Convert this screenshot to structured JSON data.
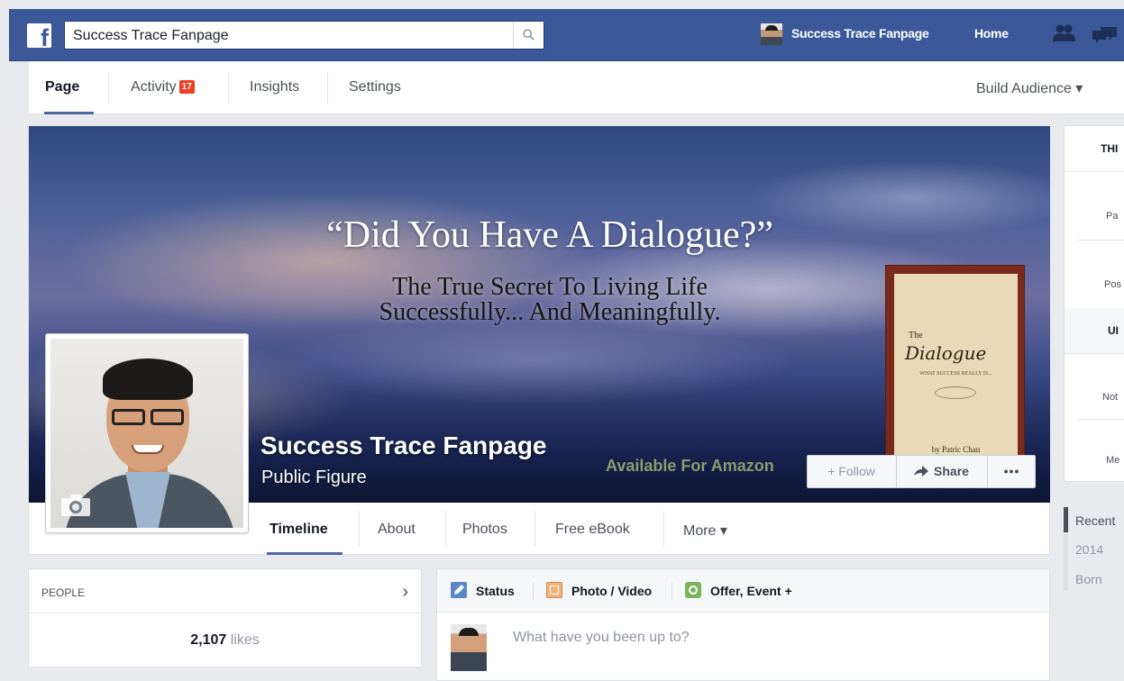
{
  "topbar": {
    "search_value": "Success Trace Fanpage",
    "user_name": "Success Trace Fanpage",
    "home_label": "Home",
    "brand_color": "#3b5998"
  },
  "page_nav": {
    "items": [
      {
        "label": "Page"
      },
      {
        "label": "Activity",
        "badge": "17"
      },
      {
        "label": "Insights"
      },
      {
        "label": "Settings"
      }
    ],
    "build_audience": "Build Audience ▾"
  },
  "cover": {
    "headline": "“Did You Have A Dialogue?”",
    "subline_1": "The True Secret To Living Life",
    "subline_2": "Successfully... And Meaningfully.",
    "book": {
      "the": "The",
      "title": "Dialogue",
      "tagline": "WHAT SUCCESS REALLY IS...",
      "author": "by Patric Chan"
    },
    "amazon_text": "Available For Amazon"
  },
  "page_info": {
    "name": "Success Trace Fanpage",
    "category": "Public Figure"
  },
  "actions": {
    "follow": "+ Follow",
    "share": "Share",
    "more": "•••"
  },
  "tabs": [
    {
      "label": "Timeline"
    },
    {
      "label": "About"
    },
    {
      "label": "Photos"
    },
    {
      "label": "Free eBook"
    },
    {
      "label": "More ▾"
    }
  ],
  "people": {
    "title": "PEOPLE",
    "likes_count": "2,107",
    "likes_label": "likes"
  },
  "composer": {
    "status": "Status",
    "photo_video": "Photo / Video",
    "offer_event": "Offer, Event +",
    "placeholder": "What have you been up to?"
  },
  "right_panel": {
    "head_1": "THI",
    "item_1": "Pa",
    "item_2": "Pos",
    "head_2": "UI",
    "item_3": "Not",
    "item_4": "Me"
  },
  "scrubber": {
    "items": [
      "Recent",
      "2014",
      "Born"
    ]
  }
}
